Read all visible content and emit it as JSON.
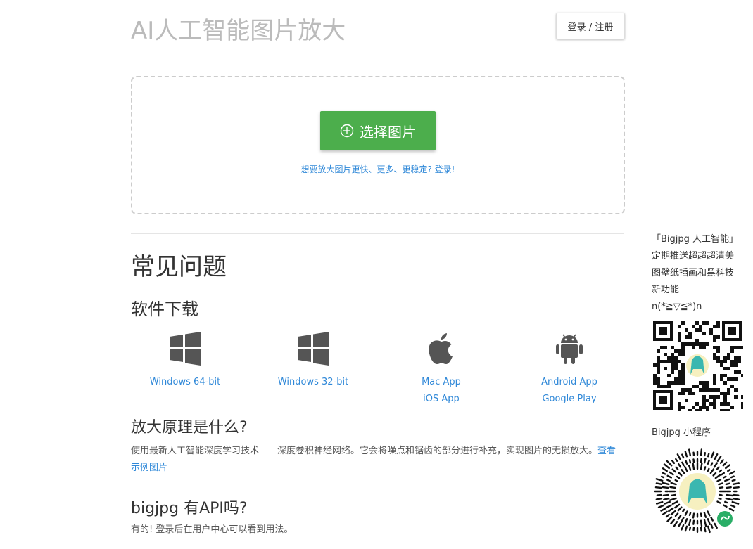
{
  "header": {
    "title": "AI人工智能图片放大",
    "login_label": "登录 / 注册"
  },
  "upload": {
    "select_label": "选择图片",
    "upsell_link": "想要放大图片更快、更多、更稳定? 登录!"
  },
  "faq": {
    "title": "常见问题",
    "download_title": "软件下载",
    "downloads": [
      {
        "icon": "windows-icon",
        "links": [
          "Windows 64-bit"
        ]
      },
      {
        "icon": "windows-icon",
        "links": [
          "Windows 32-bit"
        ]
      },
      {
        "icon": "apple-icon",
        "links": [
          "Mac App",
          "iOS App"
        ]
      },
      {
        "icon": "android-icon",
        "links": [
          "Android App",
          "Google Play"
        ]
      }
    ],
    "principle_title": "放大原理是什么?",
    "principle_text": "使用最新人工智能深度学习技术——深度卷积神经网络。它会将噪点和锯齿的部分进行补充，实现图片的无损放大。",
    "principle_link": "查看示例图片",
    "api_title": "bigjpg 有API吗?",
    "api_text": "有的! 登录后在用户中心可以看到用法。"
  },
  "sidebar": {
    "lines": [
      "「Bigjpg 人工智能」",
      "定期推送超超超清美",
      "图壁纸插画和黑科技",
      "新功能",
      "n(*≧▽≦*)n"
    ],
    "miniprogram_label": "Bigjpg 小程序"
  },
  "colors": {
    "accent": "#4cae4c",
    "link": "#2f88d8",
    "title_gray": "#bbbbbb"
  }
}
